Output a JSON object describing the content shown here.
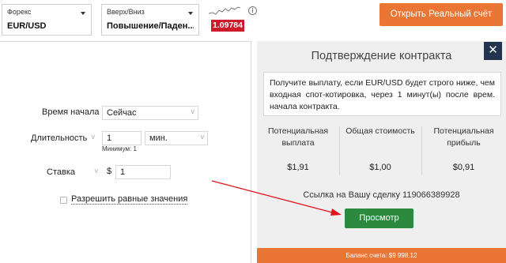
{
  "header": {
    "market_dropdown": {
      "label": "Форекс",
      "value": "EUR/USD"
    },
    "type_dropdown": {
      "label": "Вверх/Вниз",
      "value": "Повышение/Паден..."
    },
    "price": "1.09784",
    "info_icon": "info-icon",
    "real_account_button": "Открыть Реальный счёт",
    "accent_color": "#ea7534",
    "price_color": "#d0192b"
  },
  "form": {
    "start_time_label": "Время начала",
    "start_time_value": "Сейчас",
    "duration_label": "Длительность",
    "duration_value": "1",
    "duration_unit": "мин.",
    "minimum_text": "Минимум: 1",
    "stake_label": "Ставка",
    "currency_symbol": "$",
    "stake_value": "1",
    "allow_equals_label": "Разрешить равные значения"
  },
  "confirmation": {
    "title": "Подтверждение контракта",
    "close_icon": "close-icon",
    "notice": "Получите выплату, если EUR/USD будет строго ниже, чем входная спот-котировка, через 1 минут(ы) после врем. начала контракта.",
    "metrics": [
      {
        "label": "Потенциальная выплата",
        "value": "$1,91"
      },
      {
        "label": "Общая стоимость",
        "value": "$1,00"
      },
      {
        "label": "Потенциальная прибыль",
        "value": "$0,91"
      }
    ],
    "reference_text": "Ссылка на Вашу сделку 119066389928",
    "view_button": "Просмотр",
    "view_button_color": "#2b8a3e",
    "balance": "Баланс счета: $9 998,12"
  },
  "annotation": {
    "arrow_color": "#e0171d"
  }
}
